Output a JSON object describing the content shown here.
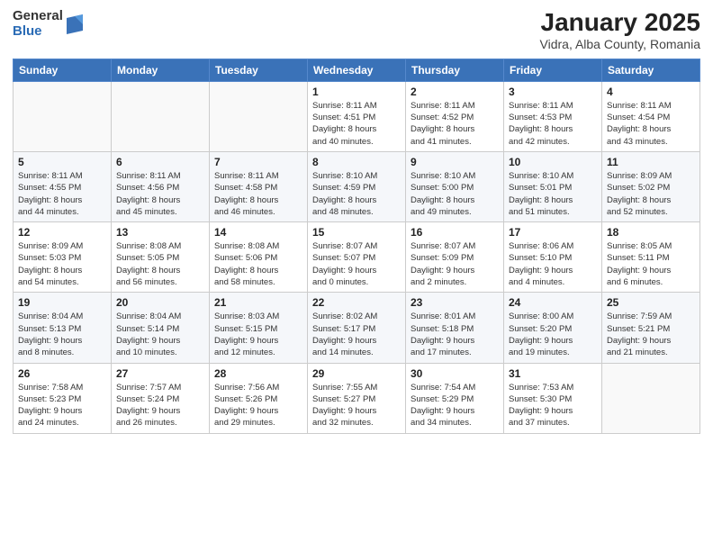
{
  "header": {
    "logo_general": "General",
    "logo_blue": "Blue",
    "month_title": "January 2025",
    "location": "Vidra, Alba County, Romania"
  },
  "weekdays": [
    "Sunday",
    "Monday",
    "Tuesday",
    "Wednesday",
    "Thursday",
    "Friday",
    "Saturday"
  ],
  "weeks": [
    [
      {
        "day": "",
        "info": ""
      },
      {
        "day": "",
        "info": ""
      },
      {
        "day": "",
        "info": ""
      },
      {
        "day": "1",
        "info": "Sunrise: 8:11 AM\nSunset: 4:51 PM\nDaylight: 8 hours\nand 40 minutes."
      },
      {
        "day": "2",
        "info": "Sunrise: 8:11 AM\nSunset: 4:52 PM\nDaylight: 8 hours\nand 41 minutes."
      },
      {
        "day": "3",
        "info": "Sunrise: 8:11 AM\nSunset: 4:53 PM\nDaylight: 8 hours\nand 42 minutes."
      },
      {
        "day": "4",
        "info": "Sunrise: 8:11 AM\nSunset: 4:54 PM\nDaylight: 8 hours\nand 43 minutes."
      }
    ],
    [
      {
        "day": "5",
        "info": "Sunrise: 8:11 AM\nSunset: 4:55 PM\nDaylight: 8 hours\nand 44 minutes."
      },
      {
        "day": "6",
        "info": "Sunrise: 8:11 AM\nSunset: 4:56 PM\nDaylight: 8 hours\nand 45 minutes."
      },
      {
        "day": "7",
        "info": "Sunrise: 8:11 AM\nSunset: 4:58 PM\nDaylight: 8 hours\nand 46 minutes."
      },
      {
        "day": "8",
        "info": "Sunrise: 8:10 AM\nSunset: 4:59 PM\nDaylight: 8 hours\nand 48 minutes."
      },
      {
        "day": "9",
        "info": "Sunrise: 8:10 AM\nSunset: 5:00 PM\nDaylight: 8 hours\nand 49 minutes."
      },
      {
        "day": "10",
        "info": "Sunrise: 8:10 AM\nSunset: 5:01 PM\nDaylight: 8 hours\nand 51 minutes."
      },
      {
        "day": "11",
        "info": "Sunrise: 8:09 AM\nSunset: 5:02 PM\nDaylight: 8 hours\nand 52 minutes."
      }
    ],
    [
      {
        "day": "12",
        "info": "Sunrise: 8:09 AM\nSunset: 5:03 PM\nDaylight: 8 hours\nand 54 minutes."
      },
      {
        "day": "13",
        "info": "Sunrise: 8:08 AM\nSunset: 5:05 PM\nDaylight: 8 hours\nand 56 minutes."
      },
      {
        "day": "14",
        "info": "Sunrise: 8:08 AM\nSunset: 5:06 PM\nDaylight: 8 hours\nand 58 minutes."
      },
      {
        "day": "15",
        "info": "Sunrise: 8:07 AM\nSunset: 5:07 PM\nDaylight: 9 hours\nand 0 minutes."
      },
      {
        "day": "16",
        "info": "Sunrise: 8:07 AM\nSunset: 5:09 PM\nDaylight: 9 hours\nand 2 minutes."
      },
      {
        "day": "17",
        "info": "Sunrise: 8:06 AM\nSunset: 5:10 PM\nDaylight: 9 hours\nand 4 minutes."
      },
      {
        "day": "18",
        "info": "Sunrise: 8:05 AM\nSunset: 5:11 PM\nDaylight: 9 hours\nand 6 minutes."
      }
    ],
    [
      {
        "day": "19",
        "info": "Sunrise: 8:04 AM\nSunset: 5:13 PM\nDaylight: 9 hours\nand 8 minutes."
      },
      {
        "day": "20",
        "info": "Sunrise: 8:04 AM\nSunset: 5:14 PM\nDaylight: 9 hours\nand 10 minutes."
      },
      {
        "day": "21",
        "info": "Sunrise: 8:03 AM\nSunset: 5:15 PM\nDaylight: 9 hours\nand 12 minutes."
      },
      {
        "day": "22",
        "info": "Sunrise: 8:02 AM\nSunset: 5:17 PM\nDaylight: 9 hours\nand 14 minutes."
      },
      {
        "day": "23",
        "info": "Sunrise: 8:01 AM\nSunset: 5:18 PM\nDaylight: 9 hours\nand 17 minutes."
      },
      {
        "day": "24",
        "info": "Sunrise: 8:00 AM\nSunset: 5:20 PM\nDaylight: 9 hours\nand 19 minutes."
      },
      {
        "day": "25",
        "info": "Sunrise: 7:59 AM\nSunset: 5:21 PM\nDaylight: 9 hours\nand 21 minutes."
      }
    ],
    [
      {
        "day": "26",
        "info": "Sunrise: 7:58 AM\nSunset: 5:23 PM\nDaylight: 9 hours\nand 24 minutes."
      },
      {
        "day": "27",
        "info": "Sunrise: 7:57 AM\nSunset: 5:24 PM\nDaylight: 9 hours\nand 26 minutes."
      },
      {
        "day": "28",
        "info": "Sunrise: 7:56 AM\nSunset: 5:26 PM\nDaylight: 9 hours\nand 29 minutes."
      },
      {
        "day": "29",
        "info": "Sunrise: 7:55 AM\nSunset: 5:27 PM\nDaylight: 9 hours\nand 32 minutes."
      },
      {
        "day": "30",
        "info": "Sunrise: 7:54 AM\nSunset: 5:29 PM\nDaylight: 9 hours\nand 34 minutes."
      },
      {
        "day": "31",
        "info": "Sunrise: 7:53 AM\nSunset: 5:30 PM\nDaylight: 9 hours\nand 37 minutes."
      },
      {
        "day": "",
        "info": ""
      }
    ]
  ]
}
